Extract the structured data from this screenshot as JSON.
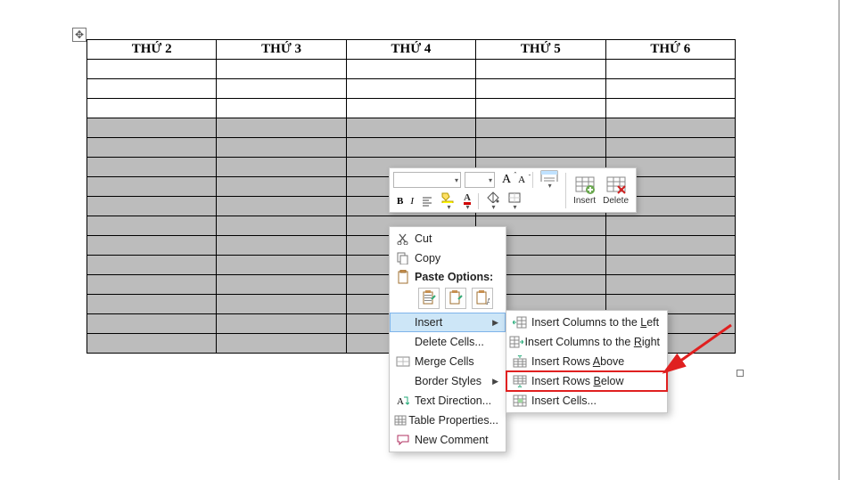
{
  "table": {
    "headers": [
      "THỨ 2",
      "THỨ 3",
      "THỨ 4",
      "THỨ 5",
      "THỨ 6"
    ],
    "body_rows": 15,
    "selected_from_row": 3
  },
  "mini_toolbar": {
    "font_name": "",
    "font_size": "",
    "insert_label": "Insert",
    "delete_label": "Delete"
  },
  "context_menu": {
    "cut": "Cut",
    "copy": "Copy",
    "paste_options_title": "Paste Options:",
    "insert": "Insert",
    "delete_cells": "Delete Cells...",
    "merge_cells": "Merge Cells",
    "border_styles": "Border Styles",
    "text_direction": "Text Direction...",
    "table_properties": "Table Properties...",
    "new_comment": "New Comment"
  },
  "insert_submenu": {
    "cols_left": "Insert Columns to the Left",
    "cols_right": "Insert Columns to the Right",
    "rows_above": "Insert Rows Above",
    "rows_below": "Insert Rows Below",
    "cells": "Insert Cells..."
  }
}
